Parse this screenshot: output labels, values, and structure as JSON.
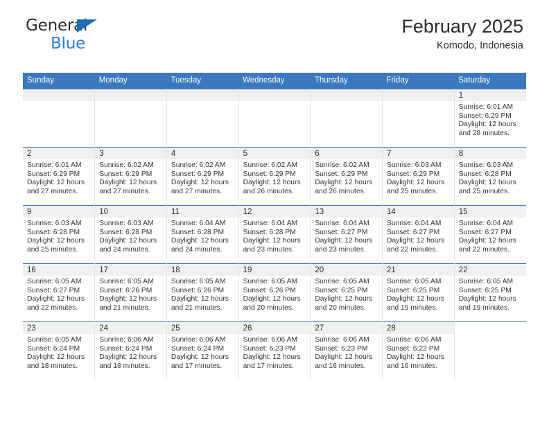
{
  "brand": {
    "name_part1": "General",
    "name_part2": "Blue",
    "accent_color": "#2a7fd4",
    "triangle_color": "#1f6cb5"
  },
  "header": {
    "month_title": "February 2025",
    "location": "Komodo, Indonesia",
    "header_bg_color": "#3a79bf"
  },
  "calendar": {
    "weekday_headers": [
      "Sunday",
      "Monday",
      "Tuesday",
      "Wednesday",
      "Thursday",
      "Friday",
      "Saturday"
    ],
    "weeks": [
      [
        {
          "day": "",
          "lines": []
        },
        {
          "day": "",
          "lines": []
        },
        {
          "day": "",
          "lines": []
        },
        {
          "day": "",
          "lines": []
        },
        {
          "day": "",
          "lines": []
        },
        {
          "day": "",
          "lines": []
        },
        {
          "day": "1",
          "lines": [
            "Sunrise: 6:01 AM",
            "Sunset: 6:29 PM",
            "Daylight: 12 hours",
            "and 28 minutes."
          ]
        }
      ],
      [
        {
          "day": "2",
          "lines": [
            "Sunrise: 6:01 AM",
            "Sunset: 6:29 PM",
            "Daylight: 12 hours",
            "and 27 minutes."
          ]
        },
        {
          "day": "3",
          "lines": [
            "Sunrise: 6:02 AM",
            "Sunset: 6:29 PM",
            "Daylight: 12 hours",
            "and 27 minutes."
          ]
        },
        {
          "day": "4",
          "lines": [
            "Sunrise: 6:02 AM",
            "Sunset: 6:29 PM",
            "Daylight: 12 hours",
            "and 27 minutes."
          ]
        },
        {
          "day": "5",
          "lines": [
            "Sunrise: 6:02 AM",
            "Sunset: 6:29 PM",
            "Daylight: 12 hours",
            "and 26 minutes."
          ]
        },
        {
          "day": "6",
          "lines": [
            "Sunrise: 6:02 AM",
            "Sunset: 6:29 PM",
            "Daylight: 12 hours",
            "and 26 minutes."
          ]
        },
        {
          "day": "7",
          "lines": [
            "Sunrise: 6:03 AM",
            "Sunset: 6:29 PM",
            "Daylight: 12 hours",
            "and 25 minutes."
          ]
        },
        {
          "day": "8",
          "lines": [
            "Sunrise: 6:03 AM",
            "Sunset: 6:28 PM",
            "Daylight: 12 hours",
            "and 25 minutes."
          ]
        }
      ],
      [
        {
          "day": "9",
          "lines": [
            "Sunrise: 6:03 AM",
            "Sunset: 6:28 PM",
            "Daylight: 12 hours",
            "and 25 minutes."
          ]
        },
        {
          "day": "10",
          "lines": [
            "Sunrise: 6:03 AM",
            "Sunset: 6:28 PM",
            "Daylight: 12 hours",
            "and 24 minutes."
          ]
        },
        {
          "day": "11",
          "lines": [
            "Sunrise: 6:04 AM",
            "Sunset: 6:28 PM",
            "Daylight: 12 hours",
            "and 24 minutes."
          ]
        },
        {
          "day": "12",
          "lines": [
            "Sunrise: 6:04 AM",
            "Sunset: 6:28 PM",
            "Daylight: 12 hours",
            "and 23 minutes."
          ]
        },
        {
          "day": "13",
          "lines": [
            "Sunrise: 6:04 AM",
            "Sunset: 6:27 PM",
            "Daylight: 12 hours",
            "and 23 minutes."
          ]
        },
        {
          "day": "14",
          "lines": [
            "Sunrise: 6:04 AM",
            "Sunset: 6:27 PM",
            "Daylight: 12 hours",
            "and 22 minutes."
          ]
        },
        {
          "day": "15",
          "lines": [
            "Sunrise: 6:04 AM",
            "Sunset: 6:27 PM",
            "Daylight: 12 hours",
            "and 22 minutes."
          ]
        }
      ],
      [
        {
          "day": "16",
          "lines": [
            "Sunrise: 6:05 AM",
            "Sunset: 6:27 PM",
            "Daylight: 12 hours",
            "and 22 minutes."
          ]
        },
        {
          "day": "17",
          "lines": [
            "Sunrise: 6:05 AM",
            "Sunset: 6:26 PM",
            "Daylight: 12 hours",
            "and 21 minutes."
          ]
        },
        {
          "day": "18",
          "lines": [
            "Sunrise: 6:05 AM",
            "Sunset: 6:26 PM",
            "Daylight: 12 hours",
            "and 21 minutes."
          ]
        },
        {
          "day": "19",
          "lines": [
            "Sunrise: 6:05 AM",
            "Sunset: 6:26 PM",
            "Daylight: 12 hours",
            "and 20 minutes."
          ]
        },
        {
          "day": "20",
          "lines": [
            "Sunrise: 6:05 AM",
            "Sunset: 6:25 PM",
            "Daylight: 12 hours",
            "and 20 minutes."
          ]
        },
        {
          "day": "21",
          "lines": [
            "Sunrise: 6:05 AM",
            "Sunset: 6:25 PM",
            "Daylight: 12 hours",
            "and 19 minutes."
          ]
        },
        {
          "day": "22",
          "lines": [
            "Sunrise: 6:05 AM",
            "Sunset: 6:25 PM",
            "Daylight: 12 hours",
            "and 19 minutes."
          ]
        }
      ],
      [
        {
          "day": "23",
          "lines": [
            "Sunrise: 6:05 AM",
            "Sunset: 6:24 PM",
            "Daylight: 12 hours",
            "and 18 minutes."
          ]
        },
        {
          "day": "24",
          "lines": [
            "Sunrise: 6:06 AM",
            "Sunset: 6:24 PM",
            "Daylight: 12 hours",
            "and 18 minutes."
          ]
        },
        {
          "day": "25",
          "lines": [
            "Sunrise: 6:06 AM",
            "Sunset: 6:24 PM",
            "Daylight: 12 hours",
            "and 17 minutes."
          ]
        },
        {
          "day": "26",
          "lines": [
            "Sunrise: 6:06 AM",
            "Sunset: 6:23 PM",
            "Daylight: 12 hours",
            "and 17 minutes."
          ]
        },
        {
          "day": "27",
          "lines": [
            "Sunrise: 6:06 AM",
            "Sunset: 6:23 PM",
            "Daylight: 12 hours",
            "and 16 minutes."
          ]
        },
        {
          "day": "28",
          "lines": [
            "Sunrise: 6:06 AM",
            "Sunset: 6:22 PM",
            "Daylight: 12 hours",
            "and 16 minutes."
          ]
        },
        {
          "day": "",
          "lines": [],
          "blank": true
        }
      ]
    ]
  }
}
